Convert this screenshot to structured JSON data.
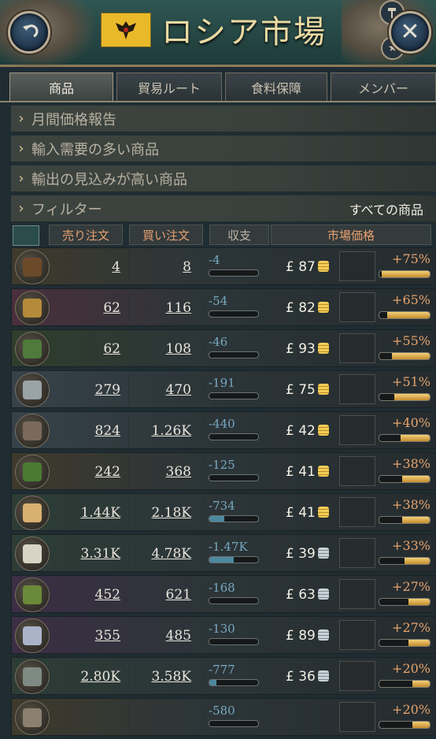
{
  "header": {
    "title": "ロシア市場",
    "back_icon": "back-arrow-icon",
    "close_icon": "close-icon"
  },
  "tabs": [
    {
      "label": "商品",
      "active": true
    },
    {
      "label": "貿易ルート",
      "active": false
    },
    {
      "label": "食料保障",
      "active": false
    },
    {
      "label": "メンバー",
      "active": false
    }
  ],
  "sections": {
    "monthly": "月間価格報告",
    "import": "輸入需要の多い商品",
    "export": "輸出の見込みが高い商品",
    "filter": "フィルター",
    "filter_value": "すべての商品"
  },
  "columns": {
    "sell": "売り注文",
    "buy": "買い注文",
    "balance": "収支",
    "price": "市場価格"
  },
  "goods": [
    {
      "icon": "small-arms-icon",
      "bg": "#3e3a2c",
      "sell": "4",
      "buy": "8",
      "balance": "-4",
      "balance_fill": 0.0,
      "price": "£ 87",
      "coin": "gold",
      "pct": "+75%",
      "pct_fill": 0.95
    },
    {
      "icon": "ammunition-icon",
      "bg": "#4a2f3c",
      "sell": "62",
      "buy": "116",
      "balance": "-54",
      "balance_fill": 0.0,
      "price": "£ 82",
      "coin": "gold",
      "pct": "+65%",
      "pct_fill": 0.85
    },
    {
      "icon": "tools-icon",
      "bg": "#2f3e2c",
      "sell": "62",
      "buy": "108",
      "balance": "-46",
      "balance_fill": 0.0,
      "price": "£ 93",
      "coin": "gold",
      "pct": "+55%",
      "pct_fill": 0.75
    },
    {
      "icon": "steel-icon",
      "bg": "#36424a",
      "sell": "279",
      "buy": "470",
      "balance": "-191",
      "balance_fill": 0.0,
      "price": "£ 75",
      "coin": "gold",
      "pct": "+51%",
      "pct_fill": 0.7
    },
    {
      "icon": "iron-icon",
      "bg": "#36424a",
      "sell": "824",
      "buy": "1.26K",
      "balance": "-440",
      "balance_fill": 0.0,
      "price": "£ 42",
      "coin": "gold",
      "pct": "+40%",
      "pct_fill": 0.58
    },
    {
      "icon": "fertilizer-icon",
      "bg": "#3e3a2c",
      "sell": "242",
      "buy": "368",
      "balance": "-125",
      "balance_fill": 0.0,
      "price": "£ 41",
      "coin": "gold",
      "pct": "+38%",
      "pct_fill": 0.55
    },
    {
      "icon": "paper-icon",
      "bg": "#2c3d36",
      "sell": "1.44K",
      "buy": "2.18K",
      "balance": "-734",
      "balance_fill": 0.3,
      "price": "£ 41",
      "coin": "gold",
      "pct": "+38%",
      "pct_fill": 0.55
    },
    {
      "icon": "clothes-icon",
      "bg": "#2c3d36",
      "sell": "3.31K",
      "buy": "4.78K",
      "balance": "-1.47K",
      "balance_fill": 0.5,
      "price": "£ 39",
      "coin": "silver",
      "pct": "+33%",
      "pct_fill": 0.5
    },
    {
      "icon": "tobacco-icon",
      "bg": "#3c2e44",
      "sell": "452",
      "buy": "621",
      "balance": "-168",
      "balance_fill": 0.0,
      "price": "£ 63",
      "coin": "silver",
      "pct": "+27%",
      "pct_fill": 0.42
    },
    {
      "icon": "porcelain-icon",
      "bg": "#3c2e44",
      "sell": "355",
      "buy": "485",
      "balance": "-130",
      "balance_fill": 0.0,
      "price": "£ 89",
      "coin": "silver",
      "pct": "+27%",
      "pct_fill": 0.42
    },
    {
      "icon": "furniture-icon",
      "bg": "#2c3d36",
      "sell": "2.80K",
      "buy": "3.58K",
      "balance": "-777",
      "balance_fill": 0.15,
      "price": "£ 36",
      "coin": "silver",
      "pct": "+20%",
      "pct_fill": 0.34
    },
    {
      "icon": "goods-icon",
      "bg": "#3e3a2c",
      "sell": "",
      "buy": "",
      "balance": "-580",
      "balance_fill": 0.0,
      "price": "",
      "coin": "silver",
      "pct": "+20%",
      "pct_fill": 0.34
    }
  ]
}
